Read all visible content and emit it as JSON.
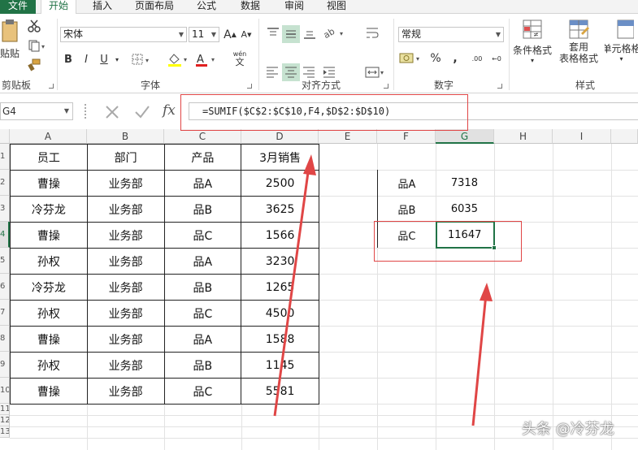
{
  "ribbon": {
    "tabs": [
      {
        "id": "file",
        "label": "文件"
      },
      {
        "id": "home",
        "label": "开始"
      },
      {
        "id": "insert",
        "label": "插入"
      },
      {
        "id": "layout",
        "label": "页面布局"
      },
      {
        "id": "formulas",
        "label": "公式"
      },
      {
        "id": "data",
        "label": "数据"
      },
      {
        "id": "review",
        "label": "审阅"
      },
      {
        "id": "view",
        "label": "视图"
      }
    ],
    "clipboard": {
      "paste_label": "贴贴",
      "group_label": "剪贴板"
    },
    "font": {
      "name": "宋体",
      "size": "11",
      "group_label": "字体",
      "bold": "B",
      "italic": "I",
      "underline": "U",
      "grow": "A",
      "shrink": "A",
      "font_color": "A",
      "wen": "wén",
      "wen_char": "文"
    },
    "alignment": {
      "group_label": "对齐方式"
    },
    "number": {
      "format": "常规",
      "group_label": "数字",
      "percent": "%",
      "comma": ",",
      "inc_decimal": ".00",
      "dec_decimal": "←0"
    },
    "styles": {
      "conditional": "条件格式",
      "table_fmt_1": "套用",
      "table_fmt_2": "表格格式",
      "cell_style": "单元格格",
      "group_label": "样式"
    }
  },
  "formula_bar": {
    "name_box": "G4",
    "formula": "=SUMIF($C$2:$C$10,F4,$D$2:$D$10)"
  },
  "sheet": {
    "columns": [
      "A",
      "B",
      "C",
      "D",
      "E",
      "F",
      "G",
      "H",
      "I"
    ],
    "rows": [
      "1",
      "2",
      "3",
      "4",
      "5",
      "6",
      "7",
      "8",
      "9",
      "10",
      "11",
      "12",
      "13"
    ],
    "table": {
      "header": [
        "员工",
        "部门",
        "产品",
        "3月销售"
      ],
      "rows": [
        [
          "曹操",
          "业务部",
          "品A",
          "2500"
        ],
        [
          "冷芬龙",
          "业务部",
          "品B",
          "3625"
        ],
        [
          "曹操",
          "业务部",
          "品C",
          "1566"
        ],
        [
          "孙权",
          "业务部",
          "品A",
          "3230"
        ],
        [
          "冷芬龙",
          "业务部",
          "品B",
          "1265"
        ],
        [
          "孙权",
          "业务部",
          "品C",
          "4500"
        ],
        [
          "曹操",
          "业务部",
          "品A",
          "1588"
        ],
        [
          "孙权",
          "业务部",
          "品B",
          "1145"
        ],
        [
          "曹操",
          "业务部",
          "品C",
          "5581"
        ]
      ]
    },
    "summary": [
      {
        "product": "品A",
        "total": "7318"
      },
      {
        "product": "品B",
        "total": "6035"
      },
      {
        "product": "品C",
        "total": "11647"
      }
    ]
  },
  "watermark": "头条 @冷芬龙",
  "colors": {
    "excel_green": "#217346",
    "annotation_red": "#e04646"
  }
}
